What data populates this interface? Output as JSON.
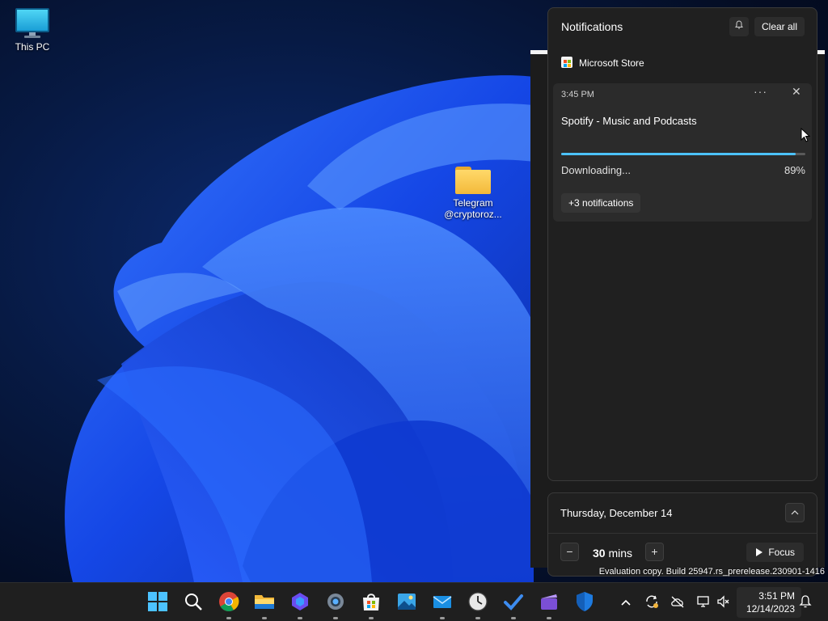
{
  "desktop": {
    "icons": [
      {
        "label": "This PC"
      },
      {
        "label": "Telegram\n@cryptoroz..."
      }
    ],
    "evaluation_text": "Evaluation copy. Build 25947.rs_prerelease.230901-1416"
  },
  "notifications": {
    "title": "Notifications",
    "dnd_icon": "bell-snooze-icon",
    "clear_all_label": "Clear all",
    "app_name": "Microsoft Store",
    "card": {
      "time": "3:45 PM",
      "more_glyph": "···",
      "close_glyph": "✕",
      "title": "Spotify - Music and Podcasts",
      "progress": 0.96,
      "status": "Downloading...",
      "percent": "89%",
      "more_notifications": "+3 notifications"
    }
  },
  "calendar": {
    "date": "Thursday, December 14",
    "toggle_glyph": "^",
    "focus": {
      "minus_glyph": "−",
      "value": "30",
      "unit": "mins",
      "plus_glyph": "+",
      "button_label": "Focus"
    }
  },
  "taskbar": {
    "apps": [
      {
        "name": "start",
        "icon": "windows-start-icon"
      },
      {
        "name": "search",
        "icon": "search-icon"
      },
      {
        "name": "chrome",
        "icon": "chrome-icon"
      },
      {
        "name": "file-explorer",
        "icon": "folder-icon"
      },
      {
        "name": "copilot",
        "icon": "copilot-icon"
      },
      {
        "name": "settings",
        "icon": "gear-icon"
      },
      {
        "name": "store",
        "icon": "store-icon"
      },
      {
        "name": "photos",
        "icon": "photos-icon"
      },
      {
        "name": "mail",
        "icon": "mail-icon"
      },
      {
        "name": "clock",
        "icon": "clock-icon"
      },
      {
        "name": "todo",
        "icon": "todo-check-icon"
      },
      {
        "name": "clipchamp",
        "icon": "clipchamp-icon"
      },
      {
        "name": "defender",
        "icon": "shield-icon"
      }
    ],
    "tray": {
      "overflow_glyph": "^",
      "time": "3:51 PM",
      "date": "12/14/2023"
    }
  },
  "colors": {
    "accent": "#4cc2ff",
    "panel_bg": "#202020",
    "card_bg": "#2b2b2b",
    "taskbar_bg": "#1f1f1f"
  }
}
